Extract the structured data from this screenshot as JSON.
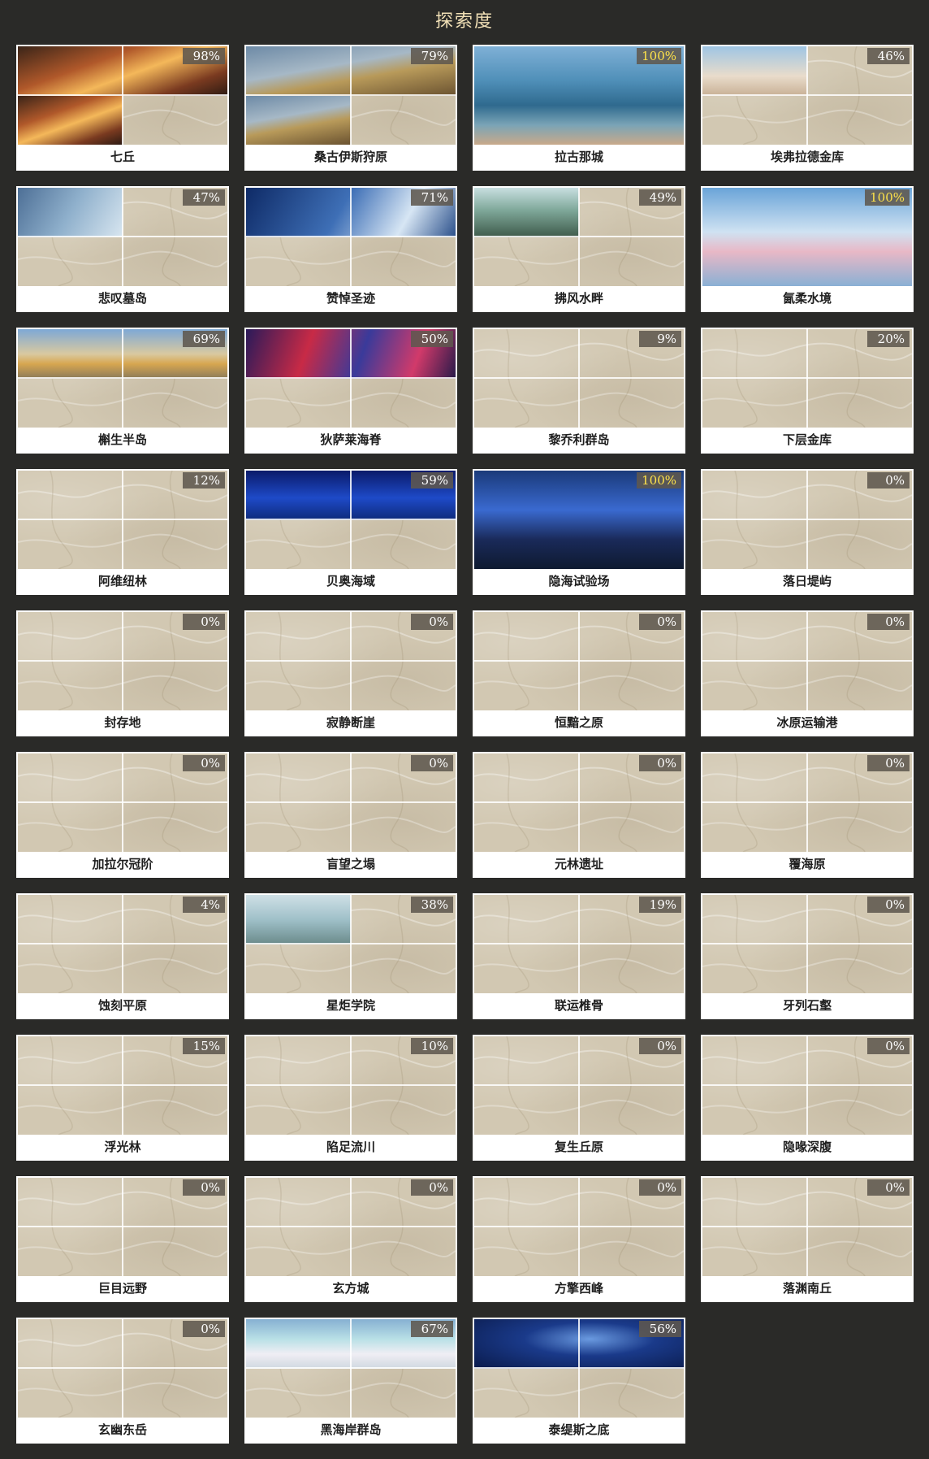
{
  "title": "探索度",
  "regions": [
    {
      "name": "七丘",
      "percent": "98%",
      "revealed": [
        0,
        1,
        2
      ],
      "scene": "sunset"
    },
    {
      "name": "桑古伊斯狩原",
      "percent": "79%",
      "revealed": [
        0,
        1,
        2
      ],
      "scene": "plain"
    },
    {
      "name": "拉古那城",
      "percent": "100%",
      "revealed": [
        0,
        1,
        2,
        3
      ],
      "scene": "city"
    },
    {
      "name": "埃弗拉德金库",
      "percent": "46%",
      "revealed": [
        0
      ],
      "scene": "sky"
    },
    {
      "name": "悲叹墓岛",
      "percent": "47%",
      "revealed": [
        0
      ],
      "scene": "storm"
    },
    {
      "name": "赞悼圣迹",
      "percent": "71%",
      "revealed": [
        0,
        1
      ],
      "scene": "night"
    },
    {
      "name": "拂风水畔",
      "percent": "49%",
      "revealed": [
        0
      ],
      "scene": "forest"
    },
    {
      "name": "氤柔水境",
      "percent": "100%",
      "revealed": [
        0,
        1,
        2,
        3
      ],
      "scene": "rainbow"
    },
    {
      "name": "槲生半岛",
      "percent": "69%",
      "revealed": [
        0,
        1
      ],
      "scene": "golden"
    },
    {
      "name": "狄萨莱海脊",
      "percent": "50%",
      "revealed": [
        0,
        1
      ],
      "scene": "nebula"
    },
    {
      "name": "黎乔利群岛",
      "percent": "9%",
      "revealed": [],
      "scene": ""
    },
    {
      "name": "下层金库",
      "percent": "20%",
      "revealed": [],
      "scene": ""
    },
    {
      "name": "阿维纽林",
      "percent": "12%",
      "revealed": [],
      "scene": ""
    },
    {
      "name": "贝奥海域",
      "percent": "59%",
      "revealed": [
        0,
        1
      ],
      "scene": "deepsea"
    },
    {
      "name": "隐海试验场",
      "percent": "100%",
      "revealed": [
        0,
        1,
        2,
        3
      ],
      "scene": "abyss"
    },
    {
      "name": "落日堤屿",
      "percent": "0%",
      "revealed": [],
      "scene": ""
    },
    {
      "name": "封存地",
      "percent": "0%",
      "revealed": [],
      "scene": ""
    },
    {
      "name": "寂静断崖",
      "percent": "0%",
      "revealed": [],
      "scene": ""
    },
    {
      "name": "恒黯之原",
      "percent": "0%",
      "revealed": [],
      "scene": ""
    },
    {
      "name": "冰原运输港",
      "percent": "0%",
      "revealed": [],
      "scene": ""
    },
    {
      "name": "加拉尔冠阶",
      "percent": "0%",
      "revealed": [],
      "scene": ""
    },
    {
      "name": "盲望之塌",
      "percent": "0%",
      "revealed": [],
      "scene": ""
    },
    {
      "name": "元林遗址",
      "percent": "0%",
      "revealed": [],
      "scene": ""
    },
    {
      "name": "覆海原",
      "percent": "0%",
      "revealed": [],
      "scene": ""
    },
    {
      "name": "蚀刻平原",
      "percent": "4%",
      "revealed": [],
      "scene": ""
    },
    {
      "name": "星炬学院",
      "percent": "38%",
      "revealed": [
        0
      ],
      "scene": "academy"
    },
    {
      "name": "联运椎骨",
      "percent": "19%",
      "revealed": [],
      "scene": ""
    },
    {
      "name": "牙列石壑",
      "percent": "0%",
      "revealed": [],
      "scene": ""
    },
    {
      "name": "浮光林",
      "percent": "15%",
      "revealed": [],
      "scene": ""
    },
    {
      "name": "陷足流川",
      "percent": "10%",
      "revealed": [],
      "scene": ""
    },
    {
      "name": "复生丘原",
      "percent": "0%",
      "revealed": [],
      "scene": ""
    },
    {
      "name": "隐喙深腹",
      "percent": "0%",
      "revealed": [],
      "scene": ""
    },
    {
      "name": "巨目远野",
      "percent": "0%",
      "revealed": [],
      "scene": ""
    },
    {
      "name": "玄方城",
      "percent": "0%",
      "revealed": [],
      "scene": ""
    },
    {
      "name": "方擎西峰",
      "percent": "0%",
      "revealed": [],
      "scene": ""
    },
    {
      "name": "落渊南丘",
      "percent": "0%",
      "revealed": [],
      "scene": ""
    },
    {
      "name": "玄幽东岳",
      "percent": "0%",
      "revealed": [],
      "scene": ""
    },
    {
      "name": "黑海岸群岛",
      "percent": "67%",
      "revealed": [
        0,
        1
      ],
      "scene": "aurora"
    },
    {
      "name": "泰缇斯之底",
      "percent": "56%",
      "revealed": [
        0,
        1
      ],
      "scene": "starfield"
    }
  ],
  "colors": {
    "background": "#2a2a28",
    "title": "#f1e0b6",
    "map_paper": "#d2c8b2",
    "percent_complete": "#ffe34a",
    "percent_normal": "#ffffff"
  }
}
